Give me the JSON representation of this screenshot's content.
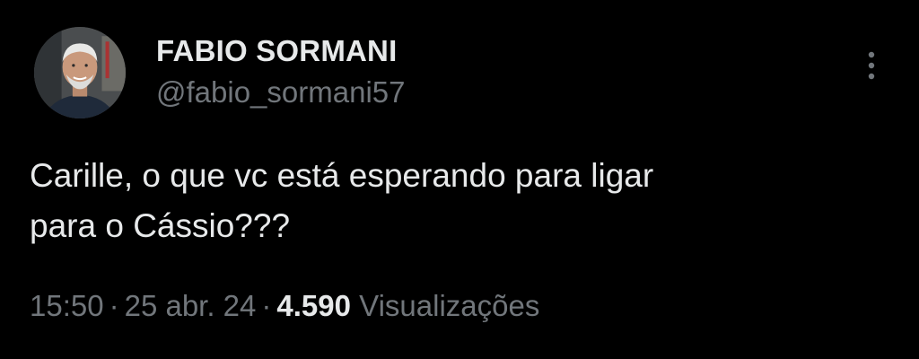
{
  "tweet": {
    "author": {
      "display_name": "FABIO SORMANI",
      "handle": "@fabio_sormani57"
    },
    "text_lines": [
      "Carille, o que vc está esperando para ligar",
      "para o Cássio???"
    ],
    "meta": {
      "time": "15:50",
      "separator": "·",
      "date": "25 abr. 24",
      "view_count": "4.590",
      "view_label": "Visualizações"
    },
    "icons": {
      "avatar": "profile-photo",
      "more": "more-vertical-icon"
    }
  },
  "colors": {
    "background": "#000000",
    "primary_text": "#e7e9ea",
    "secondary_text": "#71767b"
  }
}
